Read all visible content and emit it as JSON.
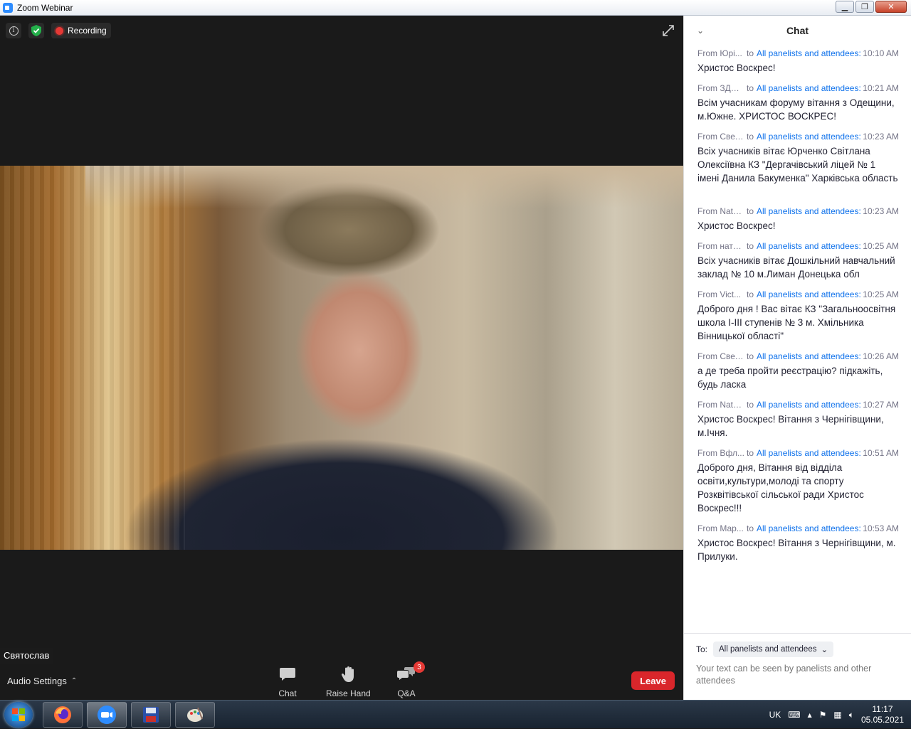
{
  "window": {
    "title": "Zoom Webinar",
    "min": "▁",
    "max": "❐",
    "close": "✕"
  },
  "meeting": {
    "recording_label": "Recording",
    "speaker_name": "Святослав",
    "audio_settings_label": "Audio Settings",
    "toolbar": {
      "chat_label": "Chat",
      "raise_hand_label": "Raise Hand",
      "qa_label": "Q&A",
      "qa_badge": "3",
      "leave_label": "Leave"
    }
  },
  "chat": {
    "title": "Chat",
    "to_word": "to",
    "messages": [
      {
        "sender": "From Юрі...",
        "recipient": "All panelists and attendees:",
        "time": "10:10 AM",
        "text": "Христос Воскрес!"
      },
      {
        "sender": "From ЗДО...",
        "recipient": "All panelists and attendees:",
        "time": "10:21 AM",
        "text": "Всім учасникам форуму вітання з Одещини, м.Южне. ХРИСТОС ВОСКРЕС!"
      },
      {
        "sender": "From Свет...",
        "recipient": "All panelists and attendees:",
        "time": "10:23 AM",
        "text": "Всіх учасників вітає Юрченко Світлана Олексіївна КЗ \"Дергачівський ліцей № 1 імені Данила Бакуменка\" Харківська область"
      },
      {
        "sender": "From Nata...",
        "recipient": "All panelists and attendees:",
        "time": "10:23 AM",
        "text": "Христос Воскрес!"
      },
      {
        "sender": "From ната...",
        "recipient": "All panelists and attendees:",
        "time": "10:25 AM",
        "text": "Всіх учасників вітає Дошкільний навчальний заклад № 10 м.Лиман Донецька обл"
      },
      {
        "sender": "From Vict...",
        "recipient": "All panelists and attendees:",
        "time": "10:25 AM",
        "text": "Доброго дня ! Вас вітає КЗ \"Загальноосвітня школа І-ІІІ ступенів № 3 м. Хмільника Вінницької області\""
      },
      {
        "sender": "From Свет...",
        "recipient": "All panelists and attendees:",
        "time": "10:26 AM",
        "text": "а де треба пройти реєстрацію? підкажіть, будь ласка"
      },
      {
        "sender": "From Nata...",
        "recipient": "All panelists and attendees:",
        "time": "10:27 AM",
        "text": "Христос Воскрес! Вітання з Чернігівщини, м.Ічня."
      },
      {
        "sender": "From Вфл...",
        "recipient": "All panelists and attendees:",
        "time": "10:51 AM",
        "text": "Доброго дня,   Вітання від відділа освіти,культури,молоді  та спорту Розквітівської сільської ради Христос Воскрес!!!"
      },
      {
        "sender": "From Мар...",
        "recipient": "All panelists and attendees:",
        "time": "10:53 AM",
        "text": "Христос Воскрес! Вітання з Чернігівщини, м. Прилуки."
      }
    ],
    "to_label": "To:",
    "to_value": "All panelists and attendees",
    "input_placeholder": "Your text can be seen by panelists and other attendees"
  },
  "taskbar": {
    "language": "UK",
    "time": "11:17",
    "date": "05.05.2021"
  }
}
